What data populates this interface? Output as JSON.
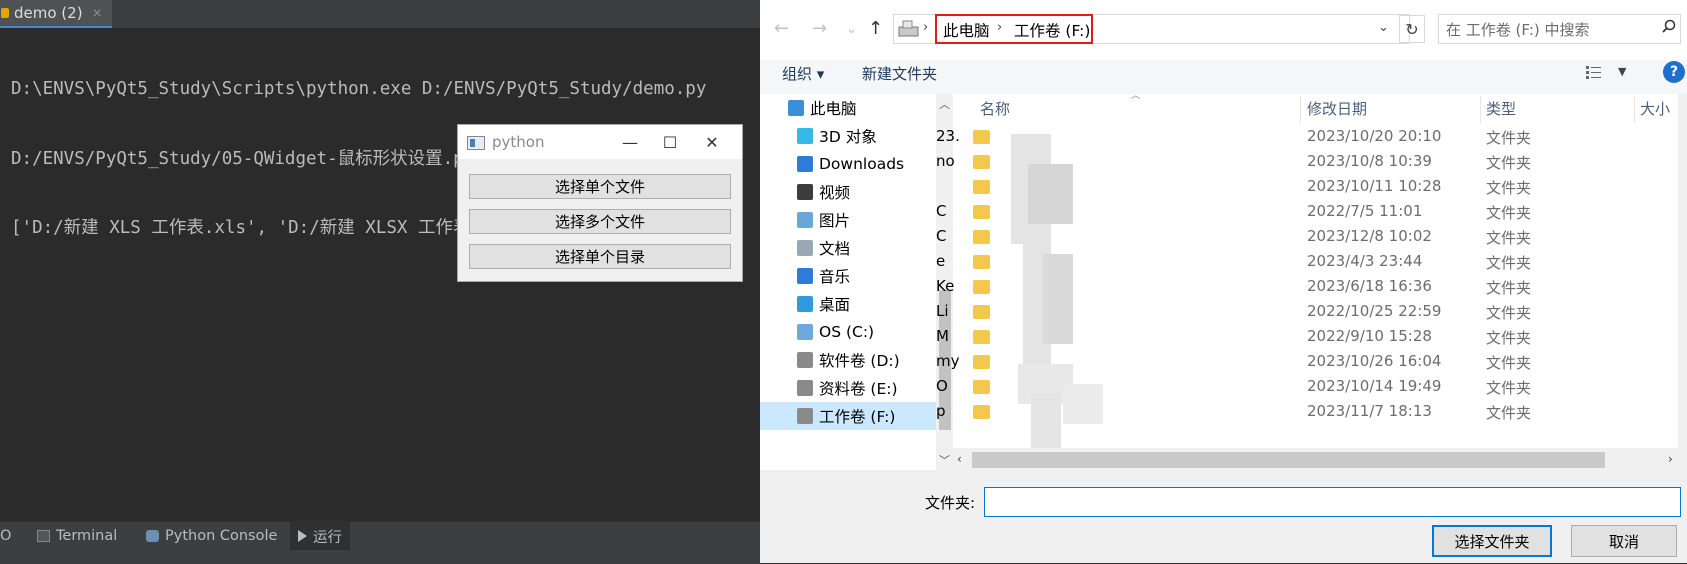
{
  "ide": {
    "tab_title": "demo (2)",
    "tab_close": "×",
    "console_lines": [
      "D:\\ENVS\\PyQt5_Study\\Scripts\\python.exe D:/ENVS/PyQt5_Study/demo.py",
      "D:/ENVS/PyQt5_Study/05-QWidget-鼠标形状设置.py",
      "['D:/新建 XLS 工作表.xls', 'D:/新建 XLSX 工作表.xlsx']"
    ],
    "bottom_tabs": [
      "O",
      "Terminal",
      "Python Console",
      "运行"
    ],
    "colors": {
      "background": "#2b2b2b",
      "text": "#bbbbbb",
      "accent": "#4a88c7"
    }
  },
  "python_window": {
    "title": "python",
    "minimize": "—",
    "maximize": "☐",
    "close": "✕",
    "buttons": [
      "选择单个文件",
      "选择多个文件",
      "选择单个目录"
    ]
  },
  "dialog": {
    "nav": {
      "back": "←",
      "forward": "→",
      "dropdown": "⌄",
      "up": "↑",
      "refresh": "↻"
    },
    "breadcrumb": [
      "此电脑",
      "工作卷 (F:)"
    ],
    "breadcrumb_sep": "›",
    "search_placeholder": "在 工作卷 (F:) 中搜索",
    "toolbar": {
      "organize": "组织 ▾",
      "new_folder": "新建文件夹",
      "help": "?"
    },
    "tree": [
      {
        "label": "此电脑",
        "icon": "computer-icon",
        "color": "#3b8ed8"
      },
      {
        "label": "3D 对象",
        "icon": "cube-icon",
        "color": "#35b8e8"
      },
      {
        "label": "Downloads",
        "icon": "download-icon",
        "color": "#2f7bd9"
      },
      {
        "label": "视频",
        "icon": "video-icon",
        "color": "#3c3c3c"
      },
      {
        "label": "图片",
        "icon": "picture-icon",
        "color": "#6aa6d8"
      },
      {
        "label": "文档",
        "icon": "document-icon",
        "color": "#9aa7b5"
      },
      {
        "label": "音乐",
        "icon": "music-icon",
        "color": "#2f7bd9"
      },
      {
        "label": "桌面",
        "icon": "desktop-icon",
        "color": "#2f9ae0"
      },
      {
        "label": "OS (C:)",
        "icon": "windows-drive-icon",
        "color": "#6fa8dc"
      },
      {
        "label": "软件卷 (D:)",
        "icon": "drive-icon",
        "color": "#8a8a8a"
      },
      {
        "label": "资料卷 (E:)",
        "icon": "drive-icon",
        "color": "#8a8a8a"
      },
      {
        "label": "工作卷 (F:)",
        "icon": "drive-icon",
        "color": "#8a8a8a",
        "selected": true
      }
    ],
    "columns": [
      "名称",
      "修改日期",
      "类型",
      "大小"
    ],
    "files": [
      {
        "name": "23.",
        "date": "2023/10/20 20:10",
        "type": "文件夹"
      },
      {
        "name": "no",
        "date": "2023/10/8 10:39",
        "type": "文件夹"
      },
      {
        "name": "",
        "date": "2023/10/11 10:28",
        "type": "文件夹"
      },
      {
        "name": "C",
        "date": "2022/7/5 11:01",
        "type": "文件夹"
      },
      {
        "name": "C",
        "date": "2023/12/8 10:02",
        "type": "文件夹"
      },
      {
        "name": "e",
        "date": "2023/4/3 23:44",
        "type": "文件夹"
      },
      {
        "name": "Ke",
        "date": "2023/6/18 16:36",
        "type": "文件夹"
      },
      {
        "name": "Li",
        "date": "2022/10/25 22:59",
        "type": "文件夹"
      },
      {
        "name": "M",
        "date": "2022/9/10 15:28",
        "type": "文件夹"
      },
      {
        "name": "my",
        "date": "2023/10/26 16:04",
        "type": "文件夹"
      },
      {
        "name": "O",
        "date": "2023/10/14 19:49",
        "type": "文件夹"
      },
      {
        "name": "p",
        "date": "2023/11/7 18:13",
        "type": "文件夹"
      }
    ],
    "folder_label": "文件夹:",
    "folder_value": "",
    "select_button": "选择文件夹",
    "cancel_button": "取消",
    "colors": {
      "highlight_border": "#e21b1b",
      "selection": "#cce8ff",
      "accent": "#0078d7",
      "folder": "#f2c94c"
    }
  }
}
